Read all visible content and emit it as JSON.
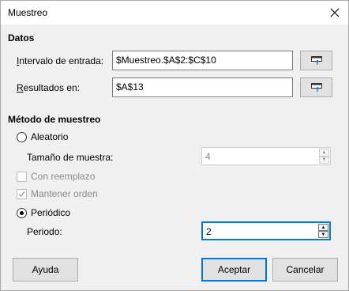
{
  "window": {
    "title": "Muestreo",
    "close_icon": "close-icon"
  },
  "datos": {
    "heading": "Datos",
    "input_range_label": "Intervalo de entrada:",
    "input_range_value": "$Muestreo.$A$2:$C$10",
    "results_label": "Resultados en:",
    "results_value": "$A$13",
    "shrink_icon": "shrink-range-icon"
  },
  "metodo": {
    "heading": "Método de muestreo",
    "aleatorio": {
      "label": "Aleatorio",
      "selected": false
    },
    "sample_size": {
      "label": "Tamaño de muestra:",
      "value": "4",
      "enabled": false
    },
    "con_reemplazo": {
      "label": "Con reemplazo",
      "checked": false,
      "enabled": false
    },
    "mantener_orden": {
      "label": "Mantener orden",
      "checked": true,
      "enabled": false
    },
    "periodico": {
      "label": "Periódico",
      "selected": true
    },
    "periodo": {
      "label": "Periodo:",
      "value": "2"
    }
  },
  "buttons": {
    "help": "Ayuda",
    "ok": "Aceptar",
    "cancel": "Cancelar"
  },
  "colors": {
    "focus_accent": "#0078d7",
    "disabled_text": "#8c8c8c"
  }
}
